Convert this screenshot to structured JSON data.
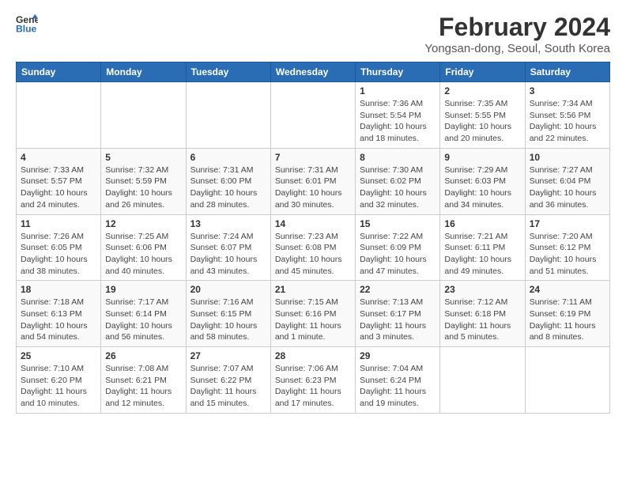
{
  "header": {
    "logo_line1": "General",
    "logo_line2": "Blue",
    "title": "February 2024",
    "subtitle": "Yongsan-dong, Seoul, South Korea"
  },
  "days_of_week": [
    "Sunday",
    "Monday",
    "Tuesday",
    "Wednesday",
    "Thursday",
    "Friday",
    "Saturday"
  ],
  "weeks": [
    [
      {
        "day": "",
        "info": ""
      },
      {
        "day": "",
        "info": ""
      },
      {
        "day": "",
        "info": ""
      },
      {
        "day": "",
        "info": ""
      },
      {
        "day": "1",
        "info": "Sunrise: 7:36 AM\nSunset: 5:54 PM\nDaylight: 10 hours\nand 18 minutes."
      },
      {
        "day": "2",
        "info": "Sunrise: 7:35 AM\nSunset: 5:55 PM\nDaylight: 10 hours\nand 20 minutes."
      },
      {
        "day": "3",
        "info": "Sunrise: 7:34 AM\nSunset: 5:56 PM\nDaylight: 10 hours\nand 22 minutes."
      }
    ],
    [
      {
        "day": "4",
        "info": "Sunrise: 7:33 AM\nSunset: 5:57 PM\nDaylight: 10 hours\nand 24 minutes."
      },
      {
        "day": "5",
        "info": "Sunrise: 7:32 AM\nSunset: 5:59 PM\nDaylight: 10 hours\nand 26 minutes."
      },
      {
        "day": "6",
        "info": "Sunrise: 7:31 AM\nSunset: 6:00 PM\nDaylight: 10 hours\nand 28 minutes."
      },
      {
        "day": "7",
        "info": "Sunrise: 7:31 AM\nSunset: 6:01 PM\nDaylight: 10 hours\nand 30 minutes."
      },
      {
        "day": "8",
        "info": "Sunrise: 7:30 AM\nSunset: 6:02 PM\nDaylight: 10 hours\nand 32 minutes."
      },
      {
        "day": "9",
        "info": "Sunrise: 7:29 AM\nSunset: 6:03 PM\nDaylight: 10 hours\nand 34 minutes."
      },
      {
        "day": "10",
        "info": "Sunrise: 7:27 AM\nSunset: 6:04 PM\nDaylight: 10 hours\nand 36 minutes."
      }
    ],
    [
      {
        "day": "11",
        "info": "Sunrise: 7:26 AM\nSunset: 6:05 PM\nDaylight: 10 hours\nand 38 minutes."
      },
      {
        "day": "12",
        "info": "Sunrise: 7:25 AM\nSunset: 6:06 PM\nDaylight: 10 hours\nand 40 minutes."
      },
      {
        "day": "13",
        "info": "Sunrise: 7:24 AM\nSunset: 6:07 PM\nDaylight: 10 hours\nand 43 minutes."
      },
      {
        "day": "14",
        "info": "Sunrise: 7:23 AM\nSunset: 6:08 PM\nDaylight: 10 hours\nand 45 minutes."
      },
      {
        "day": "15",
        "info": "Sunrise: 7:22 AM\nSunset: 6:09 PM\nDaylight: 10 hours\nand 47 minutes."
      },
      {
        "day": "16",
        "info": "Sunrise: 7:21 AM\nSunset: 6:11 PM\nDaylight: 10 hours\nand 49 minutes."
      },
      {
        "day": "17",
        "info": "Sunrise: 7:20 AM\nSunset: 6:12 PM\nDaylight: 10 hours\nand 51 minutes."
      }
    ],
    [
      {
        "day": "18",
        "info": "Sunrise: 7:18 AM\nSunset: 6:13 PM\nDaylight: 10 hours\nand 54 minutes."
      },
      {
        "day": "19",
        "info": "Sunrise: 7:17 AM\nSunset: 6:14 PM\nDaylight: 10 hours\nand 56 minutes."
      },
      {
        "day": "20",
        "info": "Sunrise: 7:16 AM\nSunset: 6:15 PM\nDaylight: 10 hours\nand 58 minutes."
      },
      {
        "day": "21",
        "info": "Sunrise: 7:15 AM\nSunset: 6:16 PM\nDaylight: 11 hours\nand 1 minute."
      },
      {
        "day": "22",
        "info": "Sunrise: 7:13 AM\nSunset: 6:17 PM\nDaylight: 11 hours\nand 3 minutes."
      },
      {
        "day": "23",
        "info": "Sunrise: 7:12 AM\nSunset: 6:18 PM\nDaylight: 11 hours\nand 5 minutes."
      },
      {
        "day": "24",
        "info": "Sunrise: 7:11 AM\nSunset: 6:19 PM\nDaylight: 11 hours\nand 8 minutes."
      }
    ],
    [
      {
        "day": "25",
        "info": "Sunrise: 7:10 AM\nSunset: 6:20 PM\nDaylight: 11 hours\nand 10 minutes."
      },
      {
        "day": "26",
        "info": "Sunrise: 7:08 AM\nSunset: 6:21 PM\nDaylight: 11 hours\nand 12 minutes."
      },
      {
        "day": "27",
        "info": "Sunrise: 7:07 AM\nSunset: 6:22 PM\nDaylight: 11 hours\nand 15 minutes."
      },
      {
        "day": "28",
        "info": "Sunrise: 7:06 AM\nSunset: 6:23 PM\nDaylight: 11 hours\nand 17 minutes."
      },
      {
        "day": "29",
        "info": "Sunrise: 7:04 AM\nSunset: 6:24 PM\nDaylight: 11 hours\nand 19 minutes."
      },
      {
        "day": "",
        "info": ""
      },
      {
        "day": "",
        "info": ""
      }
    ]
  ]
}
